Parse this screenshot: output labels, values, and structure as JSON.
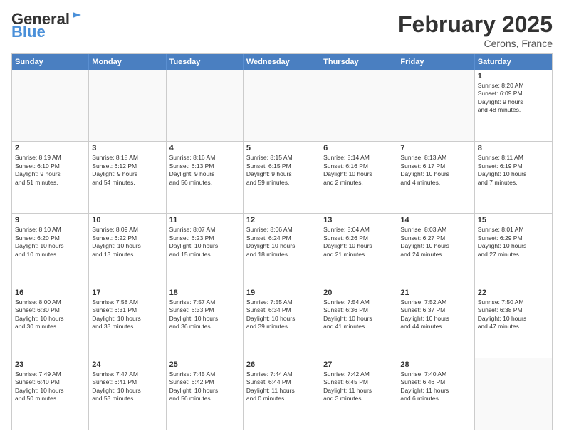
{
  "header": {
    "logo_general": "General",
    "logo_blue": "Blue",
    "month": "February 2025",
    "location": "Cerons, France"
  },
  "days_of_week": [
    "Sunday",
    "Monday",
    "Tuesday",
    "Wednesday",
    "Thursday",
    "Friday",
    "Saturday"
  ],
  "weeks": [
    [
      {
        "day": "",
        "empty": true
      },
      {
        "day": "",
        "empty": true
      },
      {
        "day": "",
        "empty": true
      },
      {
        "day": "",
        "empty": true
      },
      {
        "day": "",
        "empty": true
      },
      {
        "day": "",
        "empty": true
      },
      {
        "day": "1",
        "lines": [
          "Sunrise: 8:20 AM",
          "Sunset: 6:09 PM",
          "Daylight: 9 hours",
          "and 48 minutes."
        ]
      }
    ],
    [
      {
        "day": "2",
        "lines": [
          "Sunrise: 8:19 AM",
          "Sunset: 6:10 PM",
          "Daylight: 9 hours",
          "and 51 minutes."
        ]
      },
      {
        "day": "3",
        "lines": [
          "Sunrise: 8:18 AM",
          "Sunset: 6:12 PM",
          "Daylight: 9 hours",
          "and 54 minutes."
        ]
      },
      {
        "day": "4",
        "lines": [
          "Sunrise: 8:16 AM",
          "Sunset: 6:13 PM",
          "Daylight: 9 hours",
          "and 56 minutes."
        ]
      },
      {
        "day": "5",
        "lines": [
          "Sunrise: 8:15 AM",
          "Sunset: 6:15 PM",
          "Daylight: 9 hours",
          "and 59 minutes."
        ]
      },
      {
        "day": "6",
        "lines": [
          "Sunrise: 8:14 AM",
          "Sunset: 6:16 PM",
          "Daylight: 10 hours",
          "and 2 minutes."
        ]
      },
      {
        "day": "7",
        "lines": [
          "Sunrise: 8:13 AM",
          "Sunset: 6:17 PM",
          "Daylight: 10 hours",
          "and 4 minutes."
        ]
      },
      {
        "day": "8",
        "lines": [
          "Sunrise: 8:11 AM",
          "Sunset: 6:19 PM",
          "Daylight: 10 hours",
          "and 7 minutes."
        ]
      }
    ],
    [
      {
        "day": "9",
        "lines": [
          "Sunrise: 8:10 AM",
          "Sunset: 6:20 PM",
          "Daylight: 10 hours",
          "and 10 minutes."
        ]
      },
      {
        "day": "10",
        "lines": [
          "Sunrise: 8:09 AM",
          "Sunset: 6:22 PM",
          "Daylight: 10 hours",
          "and 13 minutes."
        ]
      },
      {
        "day": "11",
        "lines": [
          "Sunrise: 8:07 AM",
          "Sunset: 6:23 PM",
          "Daylight: 10 hours",
          "and 15 minutes."
        ]
      },
      {
        "day": "12",
        "lines": [
          "Sunrise: 8:06 AM",
          "Sunset: 6:24 PM",
          "Daylight: 10 hours",
          "and 18 minutes."
        ]
      },
      {
        "day": "13",
        "lines": [
          "Sunrise: 8:04 AM",
          "Sunset: 6:26 PM",
          "Daylight: 10 hours",
          "and 21 minutes."
        ]
      },
      {
        "day": "14",
        "lines": [
          "Sunrise: 8:03 AM",
          "Sunset: 6:27 PM",
          "Daylight: 10 hours",
          "and 24 minutes."
        ]
      },
      {
        "day": "15",
        "lines": [
          "Sunrise: 8:01 AM",
          "Sunset: 6:29 PM",
          "Daylight: 10 hours",
          "and 27 minutes."
        ]
      }
    ],
    [
      {
        "day": "16",
        "lines": [
          "Sunrise: 8:00 AM",
          "Sunset: 6:30 PM",
          "Daylight: 10 hours",
          "and 30 minutes."
        ]
      },
      {
        "day": "17",
        "lines": [
          "Sunrise: 7:58 AM",
          "Sunset: 6:31 PM",
          "Daylight: 10 hours",
          "and 33 minutes."
        ]
      },
      {
        "day": "18",
        "lines": [
          "Sunrise: 7:57 AM",
          "Sunset: 6:33 PM",
          "Daylight: 10 hours",
          "and 36 minutes."
        ]
      },
      {
        "day": "19",
        "lines": [
          "Sunrise: 7:55 AM",
          "Sunset: 6:34 PM",
          "Daylight: 10 hours",
          "and 39 minutes."
        ]
      },
      {
        "day": "20",
        "lines": [
          "Sunrise: 7:54 AM",
          "Sunset: 6:36 PM",
          "Daylight: 10 hours",
          "and 41 minutes."
        ]
      },
      {
        "day": "21",
        "lines": [
          "Sunrise: 7:52 AM",
          "Sunset: 6:37 PM",
          "Daylight: 10 hours",
          "and 44 minutes."
        ]
      },
      {
        "day": "22",
        "lines": [
          "Sunrise: 7:50 AM",
          "Sunset: 6:38 PM",
          "Daylight: 10 hours",
          "and 47 minutes."
        ]
      }
    ],
    [
      {
        "day": "23",
        "lines": [
          "Sunrise: 7:49 AM",
          "Sunset: 6:40 PM",
          "Daylight: 10 hours",
          "and 50 minutes."
        ]
      },
      {
        "day": "24",
        "lines": [
          "Sunrise: 7:47 AM",
          "Sunset: 6:41 PM",
          "Daylight: 10 hours",
          "and 53 minutes."
        ]
      },
      {
        "day": "25",
        "lines": [
          "Sunrise: 7:45 AM",
          "Sunset: 6:42 PM",
          "Daylight: 10 hours",
          "and 56 minutes."
        ]
      },
      {
        "day": "26",
        "lines": [
          "Sunrise: 7:44 AM",
          "Sunset: 6:44 PM",
          "Daylight: 11 hours",
          "and 0 minutes."
        ]
      },
      {
        "day": "27",
        "lines": [
          "Sunrise: 7:42 AM",
          "Sunset: 6:45 PM",
          "Daylight: 11 hours",
          "and 3 minutes."
        ]
      },
      {
        "day": "28",
        "lines": [
          "Sunrise: 7:40 AM",
          "Sunset: 6:46 PM",
          "Daylight: 11 hours",
          "and 6 minutes."
        ]
      },
      {
        "day": "",
        "empty": true
      }
    ]
  ]
}
